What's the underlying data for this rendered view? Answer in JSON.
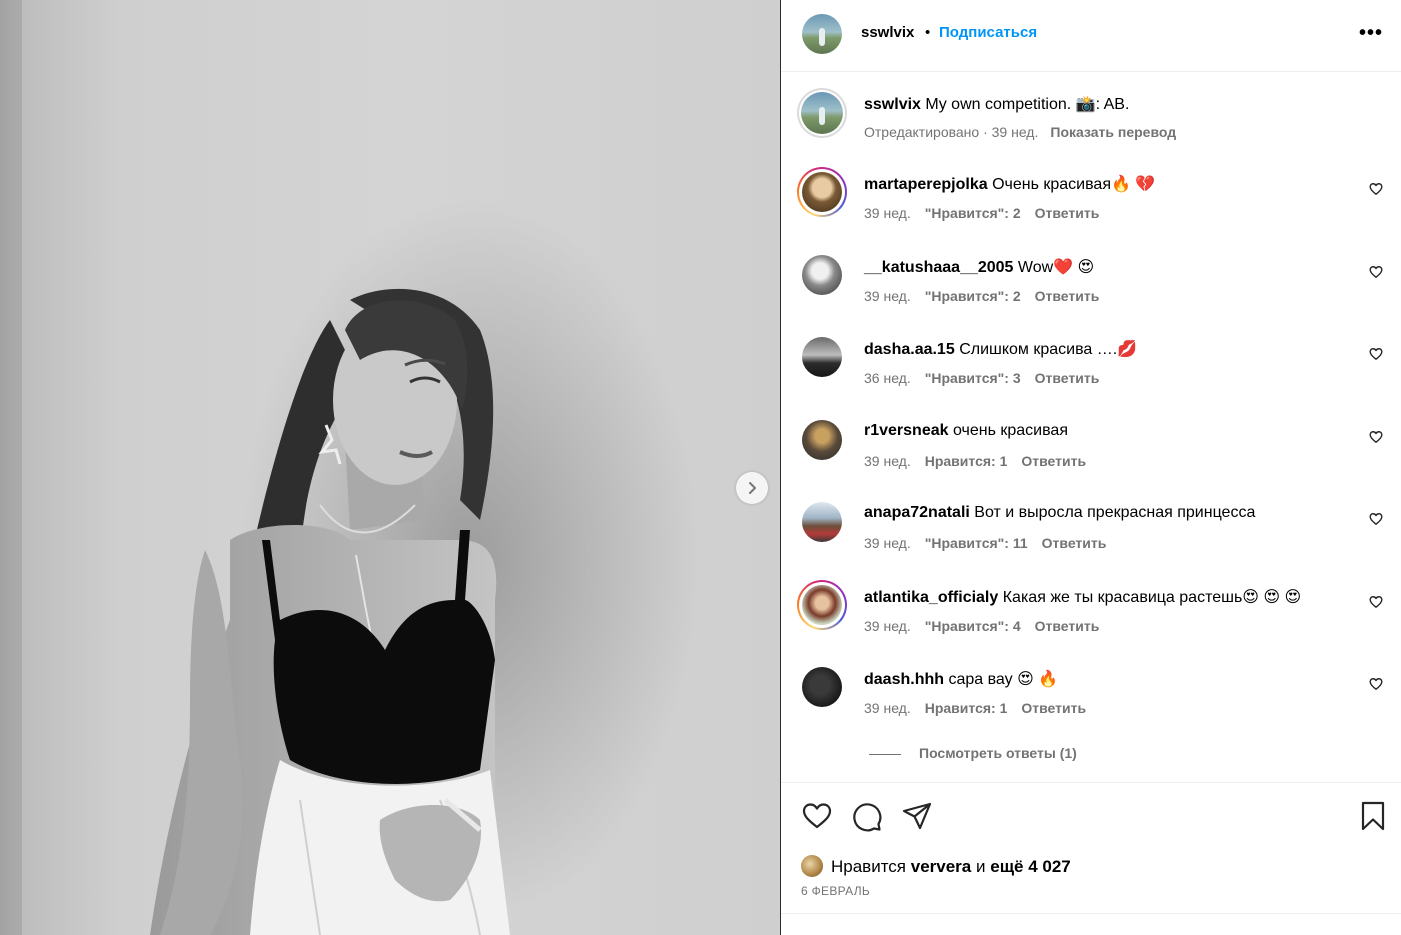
{
  "post": {
    "username": "sswlvix",
    "follow_label": "Подписаться",
    "dot": "•",
    "more_label": "•••",
    "caption_text": "My own competition. 📸: AB.",
    "caption_meta": "Отредактировано · 39 нед.",
    "translate_label": "Показать перевод"
  },
  "comments": [
    {
      "username": "martaperepjolka",
      "text": "Очень красивая🔥 💔",
      "time": "39 нед.",
      "likes": "\"Нравится\": 2",
      "reply": "Ответить"
    },
    {
      "username": "__katushaaa__2005",
      "text": "Wow❤️ 😍",
      "time": "39 нед.",
      "likes": "\"Нравится\": 2",
      "reply": "Ответить"
    },
    {
      "username": "dasha.aa.15",
      "text": "Слишком красива ….💋",
      "time": "36 нед.",
      "likes": "\"Нравится\": 3",
      "reply": "Ответить"
    },
    {
      "username": "r1versneak",
      "text": "очень красивая",
      "time": "39 нед.",
      "likes": "Нравится: 1",
      "reply": "Ответить"
    },
    {
      "username": "anapa72natali",
      "text": "Вот и выросла прекрасная принцесса",
      "time": "39 нед.",
      "likes": "\"Нравится\": 11",
      "reply": "Ответить"
    },
    {
      "username": "atlantika_officialy",
      "text": "Какая же ты красавица растешь😍 😍 😍",
      "time": "39 нед.",
      "likes": "\"Нравится\": 4",
      "reply": "Ответить"
    },
    {
      "username": "daash.hhh",
      "text": "сара вау 😍 🔥",
      "time": "39 нед.",
      "likes": "Нравится: 1",
      "reply": "Ответить"
    }
  ],
  "view_replies": "Посмотреть ответы (1)",
  "likes": {
    "prefix": "Нравится",
    "user": "ververa",
    "middle": "и",
    "rest": "ещё 4 027"
  },
  "date": "6 ФЕВРАЛЬ",
  "icons": {
    "like": "heart-icon",
    "comment": "comment-bubble-icon",
    "share": "paper-plane-icon",
    "save": "bookmark-icon",
    "next": "chevron-right-icon"
  },
  "colors": {
    "accent": "#0095f6",
    "secondary_text": "#737373"
  }
}
